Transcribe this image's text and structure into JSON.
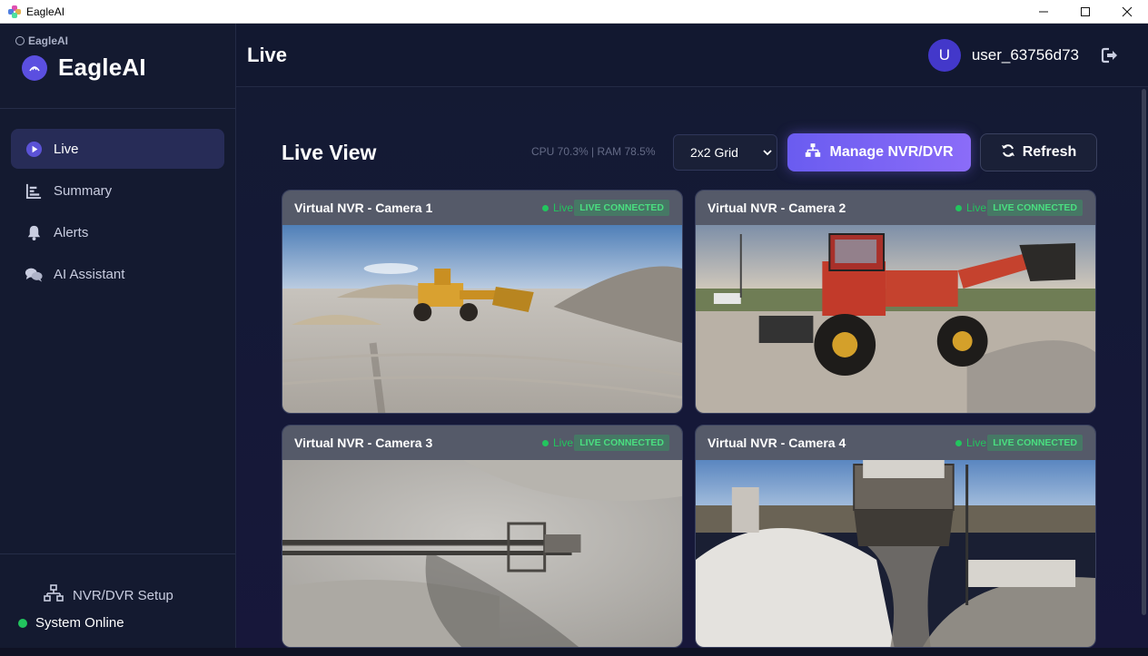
{
  "window": {
    "title": "EagleAI",
    "minimize_glyph": "—",
    "maximize_glyph": "☐",
    "close_glyph": "✕"
  },
  "sidebar": {
    "brand_small": "EagleAI",
    "brand_name": "EagleAI",
    "items": [
      {
        "label": "Live",
        "icon": "play-circle-icon",
        "active": true
      },
      {
        "label": "Summary",
        "icon": "bar-chart-icon",
        "active": false
      },
      {
        "label": "Alerts",
        "icon": "bell-icon",
        "active": false
      },
      {
        "label": "AI Assistant",
        "icon": "chat-bubbles-icon",
        "active": false
      }
    ],
    "nvr_setup_label": "NVR/DVR Setup",
    "status_label": "System Online"
  },
  "header": {
    "page_title": "Live",
    "avatar_initial": "U",
    "username": "user_63756d73"
  },
  "toolbar": {
    "section_title": "Live View",
    "stats": "CPU 70.3% | RAM 78.5%",
    "grid_select_value": "2x2 Grid",
    "manage_label": "Manage NVR/DVR",
    "refresh_label": "Refresh"
  },
  "cameras": [
    {
      "title": "Virtual NVR - Camera 1",
      "live_label": "Live",
      "badge": "LIVE CONNECTED"
    },
    {
      "title": "Virtual NVR - Camera 2",
      "live_label": "Live",
      "badge": "LIVE CONNECTED"
    },
    {
      "title": "Virtual NVR - Camera 3",
      "live_label": "Live",
      "badge": "LIVE CONNECTED"
    },
    {
      "title": "Virtual NVR - Camera 4",
      "live_label": "Live",
      "badge": "LIVE CONNECTED"
    }
  ],
  "colors": {
    "accent": "#6a5cf0",
    "online": "#22c55e",
    "sidebar_bg": "#141a30",
    "main_bg": "#141a32"
  }
}
